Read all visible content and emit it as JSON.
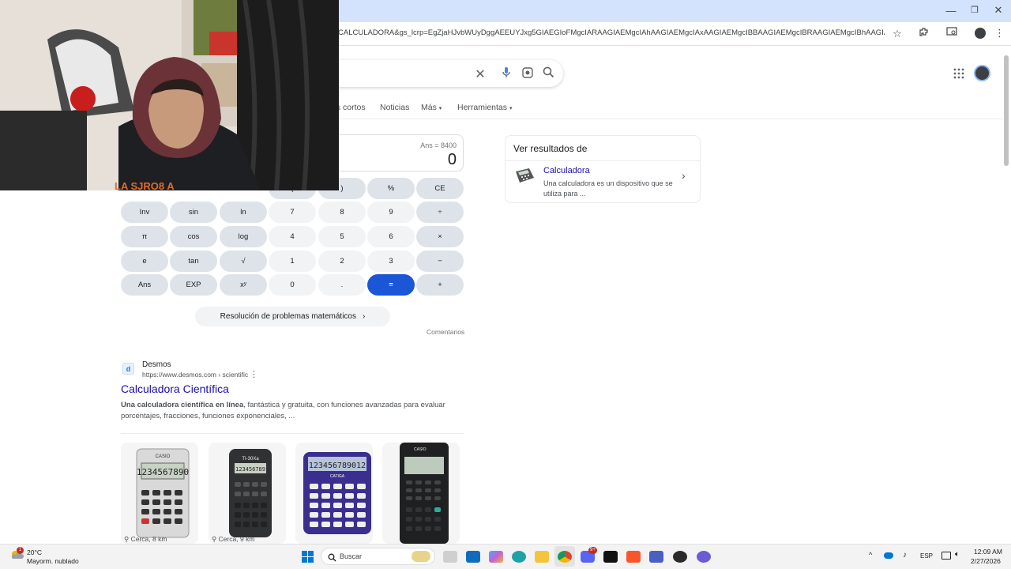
{
  "browser": {
    "url": "CALCULADORA&gs_lcrp=EgZjaHJvbWUyDggAEEUYJxg5GIAEGIoFMgcIARAAGIAEMgcIAhAAGIAEMgcIAxAAGIAEMgcIBBAAGIAEMgcIBRAAGIAEMgcIBhAAGIAEMgcIBxA..."
  },
  "search_tabs": [
    "es cortos",
    "Noticias",
    "Más",
    "Herramientas"
  ],
  "calculator": {
    "ans_line": "Ans = 8400",
    "result": "0",
    "keys": [
      [
        "(",
        ")",
        "%",
        "CE"
      ],
      [
        "Inv",
        "sin",
        "ln",
        "7",
        "8",
        "9",
        "÷"
      ],
      [
        "π",
        "cos",
        "log",
        "4",
        "5",
        "6",
        "×"
      ],
      [
        "e",
        "tan",
        "√",
        "1",
        "2",
        "3",
        "−"
      ],
      [
        "Ans",
        "EXP",
        "xʸ",
        "0",
        ".",
        "=",
        "+"
      ]
    ],
    "math_solve": "Resolución de problemas matemáticos",
    "feedback": "Comentarios"
  },
  "side_panel": {
    "title": "Ver resultados de",
    "link": "Calculadora",
    "description": "Una calculadora es un dispositivo que se utiliza para ..."
  },
  "result": {
    "site_name": "Desmos",
    "site_url": "https://www.desmos.com › scientific",
    "favicon_letter": "d",
    "title": "Calculadora Científica",
    "snippet_bold": "Una calculadora científica en línea",
    "snippet_rest": ", fantástica y gratuita, con funciones avanzadas para evaluar porcentajes, fracciones, funciones exponenciales, ...",
    "cards": [
      {
        "brand": "CASIO",
        "display": "1234567890",
        "location": "Cerca, 8 km"
      },
      {
        "brand": "TI-30Xa",
        "display": "123456789",
        "location": "Cerca, 9 km"
      },
      {
        "brand": "CATIGA",
        "display": "123456789012",
        "location": ""
      },
      {
        "brand": "CASIO",
        "display": "",
        "location": ""
      }
    ]
  },
  "webcam": {
    "caption": "LA SJRO8 A"
  },
  "taskbar": {
    "weather_temp": "20°C",
    "weather_desc": "Mayorm. nublado",
    "weather_badge": "1",
    "search_placeholder": "Buscar",
    "language": "ESP",
    "time": "12:09 AM",
    "date": "2/27/2026",
    "discord_badge": "9+"
  },
  "colors": {
    "accent": "#1a56d6",
    "link": "#1a0dab",
    "titlebar": "#d3e3fd"
  }
}
